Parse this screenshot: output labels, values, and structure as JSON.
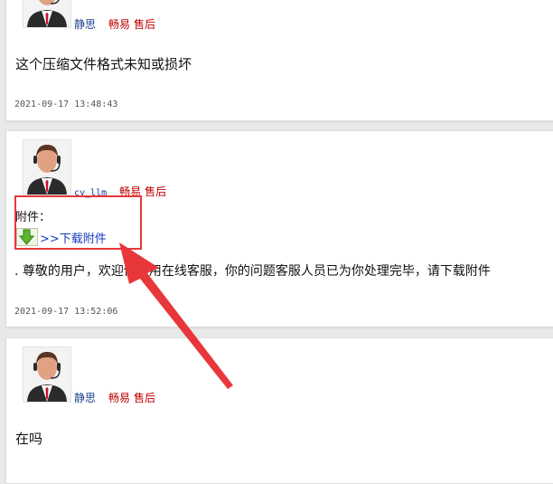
{
  "posts": [
    {
      "username": "静思",
      "tag_team": "畅易",
      "tag_role": "售后",
      "message": "这个压缩文件格式未知或损坏",
      "timestamp": "2021-09-17 13:48:43"
    },
    {
      "username": "cy_llm",
      "tag_team": "畅易",
      "tag_role": "售后",
      "attachment_label": "附件：",
      "download_link": ">>下载附件",
      "message": ". 尊敬的用户，欢迎你使用在线客服，你的问题客服人员已为你处理完毕，请下载附件",
      "timestamp": "2021-09-17 13:52:06"
    },
    {
      "username": "静思",
      "tag_team": "畅易",
      "tag_role": "售后",
      "message": "在吗"
    }
  ],
  "icons": {
    "avatar": "support-agent-avatar-icon",
    "download": "download-arrow-icon"
  },
  "colors": {
    "username": "#1a3d8f",
    "tag": "#c00000",
    "annotation": "#e8373b",
    "link": "#1a3bbf"
  }
}
